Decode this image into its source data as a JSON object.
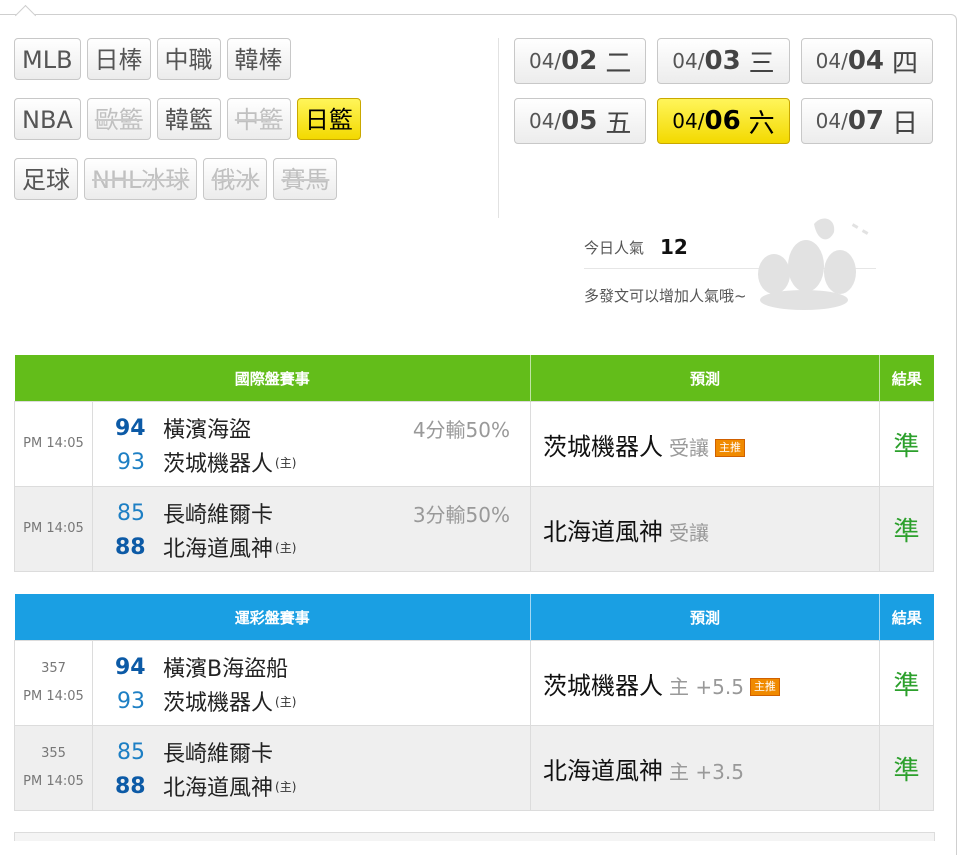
{
  "leagues": {
    "row1": [
      {
        "label": "MLB",
        "state": "normal"
      },
      {
        "label": "日棒",
        "state": "normal"
      },
      {
        "label": "中職",
        "state": "normal"
      },
      {
        "label": "韓棒",
        "state": "normal"
      }
    ],
    "row2": [
      {
        "label": "NBA",
        "state": "normal"
      },
      {
        "label": "歐籃",
        "state": "disabled"
      },
      {
        "label": "韓籃",
        "state": "normal"
      },
      {
        "label": "中籃",
        "state": "disabled"
      },
      {
        "label": "日籃",
        "state": "active"
      }
    ],
    "row3": [
      {
        "label": "足球",
        "state": "normal"
      },
      {
        "label": "NHL冰球",
        "state": "disabled"
      },
      {
        "label": "俄冰",
        "state": "disabled"
      },
      {
        "label": "賽馬",
        "state": "disabled"
      }
    ]
  },
  "dates": {
    "row1": [
      {
        "md": "04/",
        "d": "02",
        "w": "二",
        "state": "normal"
      },
      {
        "md": "04/",
        "d": "03",
        "w": "三",
        "state": "normal"
      },
      {
        "md": "04/",
        "d": "04",
        "w": "四",
        "state": "normal"
      }
    ],
    "row2": [
      {
        "md": "04/",
        "d": "05",
        "w": "五",
        "state": "normal"
      },
      {
        "md": "04/",
        "d": "06",
        "w": "六",
        "state": "active"
      },
      {
        "md": "04/",
        "d": "07",
        "w": "日",
        "state": "normal"
      }
    ]
  },
  "popularity": {
    "label": "今日人氣",
    "value": "12",
    "hint": "多發文可以增加人氣哦~"
  },
  "intl_table": {
    "headers": {
      "event": "國際盤賽事",
      "prediction": "預測",
      "result": "結果"
    },
    "rows": [
      {
        "time": "PM 14:05",
        "team_a": {
          "score": "94",
          "name": "橫濱海盜",
          "score_style": "win"
        },
        "team_b": {
          "score": "93",
          "name": "茨城機器人",
          "home": "(主)",
          "score_style": "lose"
        },
        "spread": "4分輸50%",
        "pred_team": "茨城機器人",
        "pred_note": "受讓",
        "badge": "主推",
        "result": "準"
      },
      {
        "time": "PM 14:05",
        "team_a": {
          "score": "85",
          "name": "長崎維爾卡",
          "score_style": "lose"
        },
        "team_b": {
          "score": "88",
          "name": "北海道風神",
          "home": "(主)",
          "score_style": "win"
        },
        "spread": "3分輸50%",
        "pred_team": "北海道風神",
        "pred_note": "受讓",
        "badge": "",
        "result": "準"
      }
    ]
  },
  "lottery_table": {
    "headers": {
      "event": "運彩盤賽事",
      "prediction": "預測",
      "result": "結果"
    },
    "rows": [
      {
        "num": "357",
        "time": "PM 14:05",
        "team_a": {
          "score": "94",
          "name": "橫濱B海盜船",
          "score_style": "win"
        },
        "team_b": {
          "score": "93",
          "name": "茨城機器人",
          "home": "(主)",
          "score_style": "lose"
        },
        "pred_team": "茨城機器人",
        "pred_note": "主 +5.5",
        "badge": "主推",
        "result": "準"
      },
      {
        "num": "355",
        "time": "PM 14:05",
        "team_a": {
          "score": "85",
          "name": "長崎維爾卡",
          "score_style": "lose"
        },
        "team_b": {
          "score": "88",
          "name": "北海道風神",
          "home": "(主)",
          "score_style": "win"
        },
        "pred_team": "北海道風神",
        "pred_note": "主 +3.5",
        "badge": "",
        "result": "準"
      }
    ]
  },
  "colors": {
    "intl_header": "#63bd1a",
    "lottery_header": "#1a9fe3",
    "active": "#f3d900",
    "result": "#2ca02c"
  }
}
